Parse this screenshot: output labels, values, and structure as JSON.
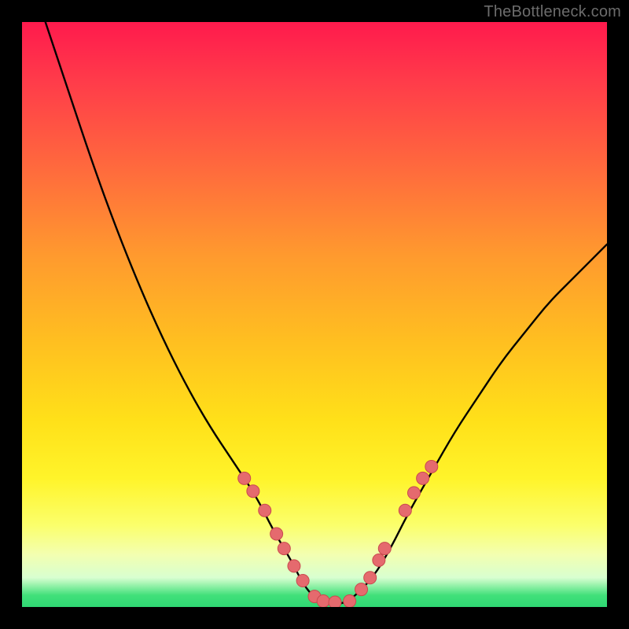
{
  "watermark": "TheBottleneck.com",
  "colors": {
    "frame": "#000000",
    "curve": "#000000",
    "bead_fill": "#e56a6e",
    "bead_stroke": "#c94a4e"
  },
  "chart_data": {
    "type": "line",
    "title": "",
    "xlabel": "",
    "ylabel": "",
    "xlim": [
      0,
      100
    ],
    "ylim": [
      0,
      100
    ],
    "series": [
      {
        "name": "bottleneck-curve",
        "x": [
          4,
          8,
          12,
          16,
          20,
          24,
          28,
          32,
          36,
          40,
          43,
          46,
          48,
          50,
          52,
          54,
          56,
          60,
          63,
          66,
          70,
          74,
          78,
          82,
          86,
          90,
          94,
          100
        ],
        "y": [
          100,
          88,
          76,
          65,
          55,
          46,
          38,
          31,
          25,
          19,
          13,
          8,
          4,
          1.5,
          0.5,
          0.5,
          1,
          5,
          10,
          16,
          23,
          30,
          36,
          42,
          47,
          52,
          56,
          62
        ]
      }
    ],
    "markers": {
      "name": "sample-beads",
      "points": [
        {
          "x": 38.0,
          "y": 22.0
        },
        {
          "x": 39.5,
          "y": 19.8
        },
        {
          "x": 41.5,
          "y": 16.5
        },
        {
          "x": 43.5,
          "y": 12.5
        },
        {
          "x": 44.8,
          "y": 10.0
        },
        {
          "x": 46.5,
          "y": 7.0
        },
        {
          "x": 48.0,
          "y": 4.5
        },
        {
          "x": 50.0,
          "y": 1.8
        },
        {
          "x": 51.5,
          "y": 1.0
        },
        {
          "x": 53.5,
          "y": 0.8
        },
        {
          "x": 56.0,
          "y": 1.0
        },
        {
          "x": 58.0,
          "y": 3.0
        },
        {
          "x": 59.5,
          "y": 5.0
        },
        {
          "x": 61.0,
          "y": 8.0
        },
        {
          "x": 62.0,
          "y": 10.0
        },
        {
          "x": 65.5,
          "y": 16.5
        },
        {
          "x": 67.0,
          "y": 19.5
        },
        {
          "x": 68.5,
          "y": 22.0
        },
        {
          "x": 70.0,
          "y": 24.0
        }
      ]
    }
  }
}
